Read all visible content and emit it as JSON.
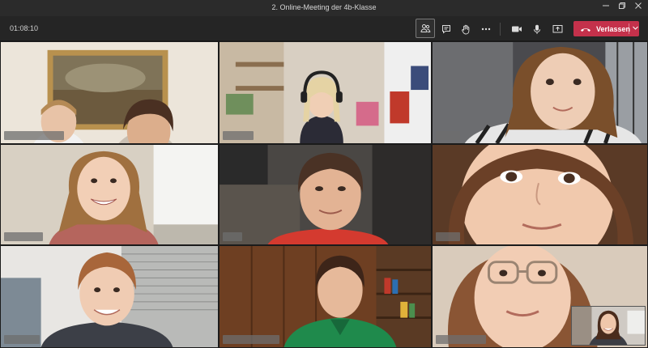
{
  "window": {
    "title": "2. Online-Meeting der 4b-Klasse",
    "controls": [
      "minimize-icon",
      "restore-icon",
      "close-icon"
    ]
  },
  "toolbar": {
    "timer": "01:08:10",
    "buttons": [
      {
        "icon": "participants-icon"
      },
      {
        "icon": "chat-icon"
      },
      {
        "icon": "raise-hand-icon"
      },
      {
        "icon": "more-options-icon"
      },
      {
        "icon": "camera-icon"
      },
      {
        "icon": "microphone-icon"
      },
      {
        "icon": "share-screen-icon"
      }
    ],
    "leave_label": "Verlassen",
    "leave_color": "#c4314b"
  },
  "participants": [
    {
      "tile": 1
    },
    {
      "tile": 2
    },
    {
      "tile": 3
    },
    {
      "tile": 4
    },
    {
      "tile": 5
    },
    {
      "tile": 6
    },
    {
      "tile": 7
    },
    {
      "tile": 8
    },
    {
      "tile": 9
    }
  ],
  "self_view": {
    "tile": "self"
  }
}
